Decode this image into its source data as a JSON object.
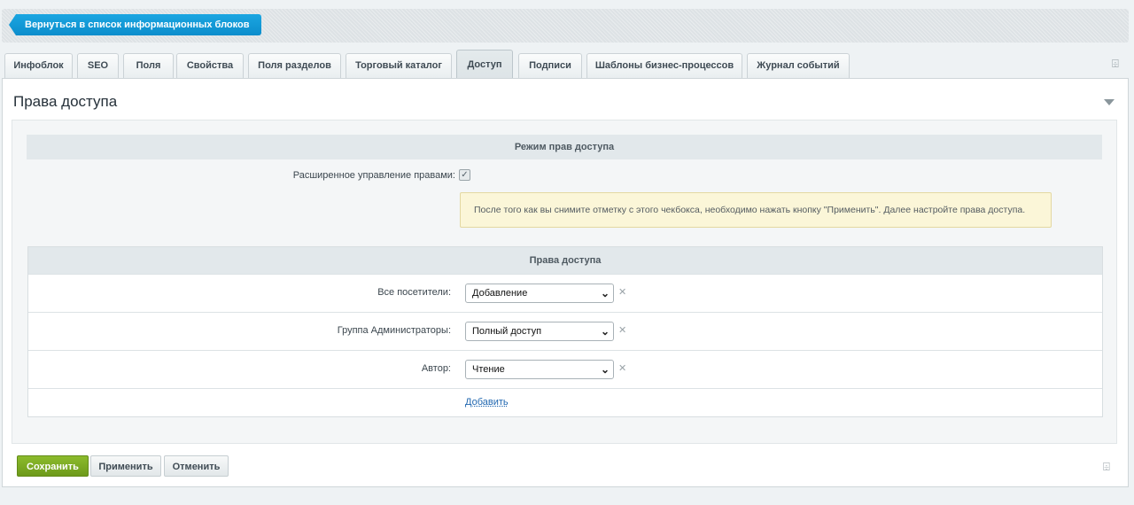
{
  "back_button": {
    "label": "Вернуться в список информационных блоков"
  },
  "tabs": [
    {
      "label": "Инфоблок"
    },
    {
      "label": "SEO"
    },
    {
      "label": "Поля"
    },
    {
      "label": "Свойства"
    },
    {
      "label": "Поля разделов"
    },
    {
      "label": "Торговый каталог"
    },
    {
      "label": "Доступ",
      "active": true
    },
    {
      "label": "Подписи"
    },
    {
      "label": "Шаблоны бизнес-процессов"
    },
    {
      "label": "Журнал событий"
    }
  ],
  "icons": {
    "pin": "pin-icon",
    "collapse": "collapse-arrow-icon",
    "delete": "close-icon",
    "checkbox": "checkmark-icon"
  },
  "panel": {
    "title": "Права доступа",
    "mode_section": {
      "header": "Режим прав доступа",
      "checkbox_label": "Расширенное управление правами:",
      "checkbox_checked": true,
      "notice": "После того как вы снимите отметку с этого чекбокса, необходимо нажать кнопку \"Применить\". Далее настройте права доступа."
    },
    "rights_section": {
      "header": "Права доступа",
      "rows": [
        {
          "label": "Все посетители:",
          "value": "Добавление"
        },
        {
          "label": "Группа Администраторы:",
          "value": "Полный доступ"
        },
        {
          "label": "Автор:",
          "value": "Чтение"
        }
      ],
      "add_link": "Добавить"
    }
  },
  "buttons": {
    "save": "Сохранить",
    "apply": "Применить",
    "cancel": "Отменить"
  },
  "colors": {
    "accent_blue": "#0c8dcc",
    "save_green": "#6d9a1a",
    "link": "#2067b0",
    "notice_bg": "#fbf6d8"
  }
}
